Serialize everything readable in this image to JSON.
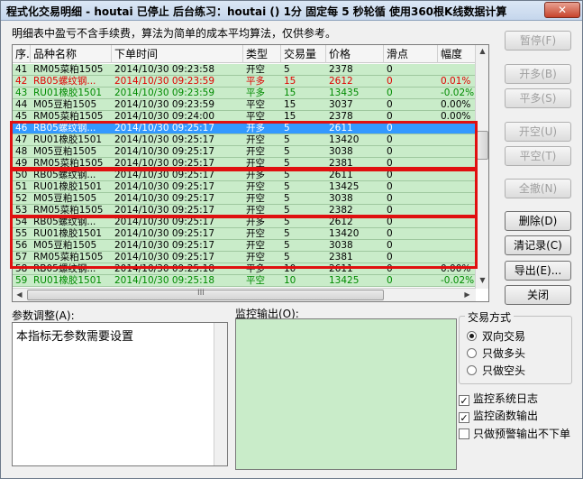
{
  "window": {
    "title": "程式化交易明细 - houtai 已停止  后台练习：houtai () 1分 固定每 5 秒轮循 使用360根K线数据计算",
    "close_label": "✕"
  },
  "notice": "明细表中盈亏不含手续费，算法为简单的成本平均算法，仅供参考。",
  "table": {
    "columns": [
      "序.",
      "品种名称",
      "下单时间",
      "类型",
      "交易量",
      "价格",
      "滑点",
      "幅度"
    ],
    "rows": [
      {
        "seq": "41",
        "name": "RM05菜粕1505",
        "time": "2014/10/30  09:23:58",
        "type": "开空",
        "qty": "5",
        "price": "2378",
        "slip": "0",
        "range": "",
        "color": "normal"
      },
      {
        "seq": "42",
        "name": "RB05螺纹钢...",
        "time": "2014/10/30  09:23:59",
        "type": "平多",
        "qty": "15",
        "price": "2612",
        "slip": "0",
        "range": "0.01%",
        "color": "red"
      },
      {
        "seq": "43",
        "name": "RU01橡胶1501",
        "time": "2014/10/30  09:23:59",
        "type": "平多",
        "qty": "15",
        "price": "13435",
        "slip": "0",
        "range": "-0.02%",
        "color": "green"
      },
      {
        "seq": "44",
        "name": "M05豆粕1505",
        "time": "2014/10/30  09:23:59",
        "type": "平空",
        "qty": "15",
        "price": "3037",
        "slip": "0",
        "range": "0.00%",
        "color": "normal"
      },
      {
        "seq": "45",
        "name": "RM05菜粕1505",
        "time": "2014/10/30  09:24:00",
        "type": "平空",
        "qty": "15",
        "price": "2378",
        "slip": "0",
        "range": "0.00%",
        "color": "normal"
      },
      {
        "seq": "46",
        "name": "RB05螺纹钢...",
        "time": "2014/10/30  09:25:17",
        "type": "开多",
        "qty": "5",
        "price": "2611",
        "slip": "0",
        "range": "",
        "color": "selected"
      },
      {
        "seq": "47",
        "name": "RU01橡胶1501",
        "time": "2014/10/30  09:25:17",
        "type": "开空",
        "qty": "5",
        "price": "13420",
        "slip": "0",
        "range": "",
        "color": "normal"
      },
      {
        "seq": "48",
        "name": "M05豆粕1505",
        "time": "2014/10/30  09:25:17",
        "type": "开空",
        "qty": "5",
        "price": "3038",
        "slip": "0",
        "range": "",
        "color": "normal"
      },
      {
        "seq": "49",
        "name": "RM05菜粕1505",
        "time": "2014/10/30  09:25:17",
        "type": "开空",
        "qty": "5",
        "price": "2381",
        "slip": "0",
        "range": "",
        "color": "normal"
      },
      {
        "seq": "50",
        "name": "RB05螺纹钢...",
        "time": "2014/10/30  09:25:17",
        "type": "开多",
        "qty": "5",
        "price": "2611",
        "slip": "0",
        "range": "",
        "color": "normal"
      },
      {
        "seq": "51",
        "name": "RU01橡胶1501",
        "time": "2014/10/30  09:25:17",
        "type": "开空",
        "qty": "5",
        "price": "13425",
        "slip": "0",
        "range": "",
        "color": "normal"
      },
      {
        "seq": "52",
        "name": "M05豆粕1505",
        "time": "2014/10/30  09:25:17",
        "type": "开空",
        "qty": "5",
        "price": "3038",
        "slip": "0",
        "range": "",
        "color": "normal"
      },
      {
        "seq": "53",
        "name": "RM05菜粕1505",
        "time": "2014/10/30  09:25:17",
        "type": "开空",
        "qty": "5",
        "price": "2382",
        "slip": "0",
        "range": "",
        "color": "normal"
      },
      {
        "seq": "54",
        "name": "RB05螺纹钢...",
        "time": "2014/10/30  09:25:17",
        "type": "开多",
        "qty": "5",
        "price": "2612",
        "slip": "0",
        "range": "",
        "color": "normal"
      },
      {
        "seq": "55",
        "name": "RU01橡胶1501",
        "time": "2014/10/30  09:25:17",
        "type": "开空",
        "qty": "5",
        "price": "13420",
        "slip": "0",
        "range": "",
        "color": "normal"
      },
      {
        "seq": "56",
        "name": "M05豆粕1505",
        "time": "2014/10/30  09:25:17",
        "type": "开空",
        "qty": "5",
        "price": "3038",
        "slip": "0",
        "range": "",
        "color": "normal"
      },
      {
        "seq": "57",
        "name": "RM05菜粕1505",
        "time": "2014/10/30  09:25:17",
        "type": "开空",
        "qty": "5",
        "price": "2381",
        "slip": "0",
        "range": "",
        "color": "normal"
      },
      {
        "seq": "58",
        "name": "RB05螺纹钢...",
        "time": "2014/10/30  09:25:18",
        "type": "平多",
        "qty": "10",
        "price": "2611",
        "slip": "0",
        "range": "0.00%",
        "color": "normal"
      },
      {
        "seq": "59",
        "name": "RU01橡胶1501",
        "time": "2014/10/30  09:25:18",
        "type": "平空",
        "qty": "10",
        "price": "13425",
        "slip": "0",
        "range": "-0.02%",
        "color": "green"
      }
    ],
    "hscroll_grip": "III"
  },
  "buttons": {
    "pause": "暂停(F)",
    "open_long": "开多(B)",
    "close_long": "平多(S)",
    "open_short": "开空(U)",
    "close_short": "平空(T)",
    "close_all": "全撤(N)",
    "delete": "删除(D)",
    "clear": "清记录(C)",
    "export": "导出(E)...",
    "close": "关闭"
  },
  "params": {
    "label": "参数调整(A):",
    "text": "本指标无参数需要设置"
  },
  "monitor": {
    "label": "监控输出(O):"
  },
  "trade_mode": {
    "legend": "交易方式",
    "options": [
      "双向交易",
      "只做多头",
      "只做空头"
    ],
    "selected_index": 0
  },
  "checks": [
    {
      "label": "监控系统日志",
      "checked": true
    },
    {
      "label": "监控函数输出",
      "checked": true
    },
    {
      "label": "只做预警输出不下单",
      "checked": false
    }
  ],
  "colors": {
    "row_bg": "#c9ecc9",
    "selected_bg": "#3399ff",
    "red_text": "#e00000",
    "green_text": "#008a00",
    "highlight_box": "#e01010"
  }
}
